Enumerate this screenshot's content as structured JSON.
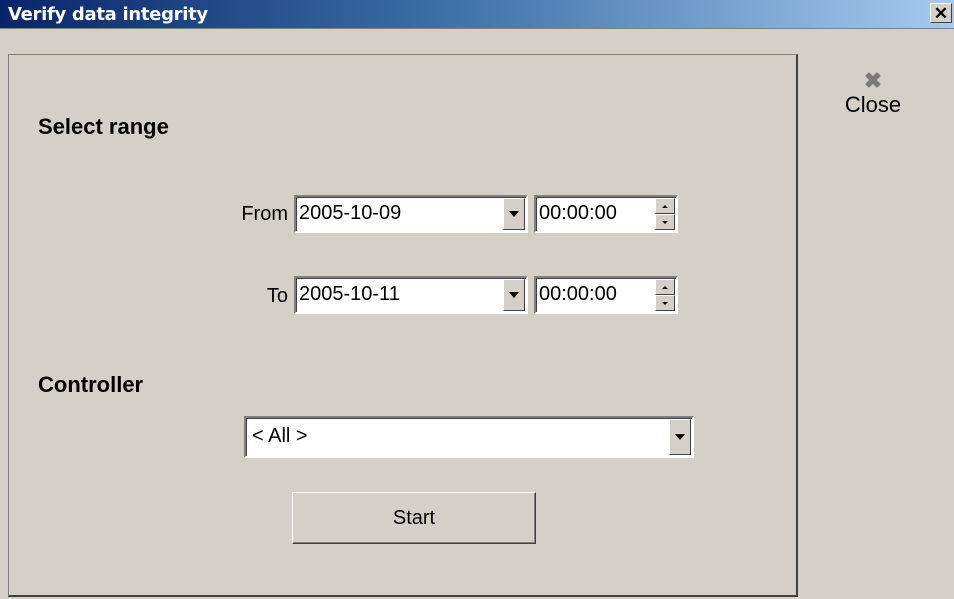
{
  "window": {
    "title": "Verify data integrity",
    "close_glyph": "✕"
  },
  "side": {
    "close_icon": "close-x-icon",
    "close_glyph": "✖",
    "close_label": "Close"
  },
  "range": {
    "heading": "Select range",
    "from_label": "From",
    "from_date": "2005-10-09",
    "from_time": "00:00:00",
    "to_label": "To",
    "to_date": "2005-10-11",
    "to_time": "00:00:00"
  },
  "controller": {
    "heading": "Controller",
    "selected": "< All >"
  },
  "actions": {
    "start_label": "Start"
  },
  "colors": {
    "window_bg": "#d4d0c8",
    "titlebar_start": "#0a246a",
    "titlebar_end": "#a6caf0"
  }
}
